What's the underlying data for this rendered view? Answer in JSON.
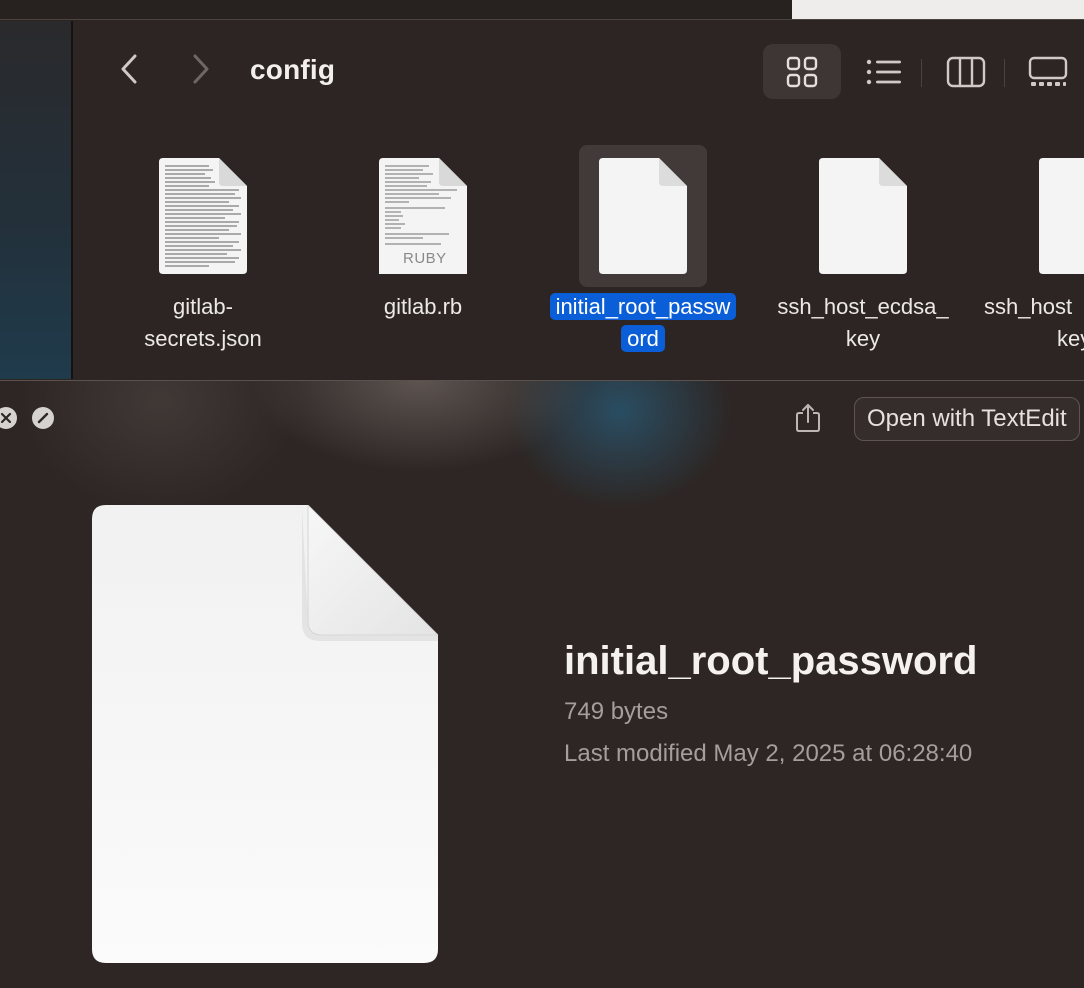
{
  "finder": {
    "folder_title": "config",
    "files": [
      {
        "name_line1": "gitlab-",
        "name_line2": "secrets.json",
        "type": "json-text-preview"
      },
      {
        "name_line1": "gitlab.rb",
        "name_line2": "",
        "type": "ruby-text-preview",
        "badge": "RUBY"
      },
      {
        "name_line1": "initial_root_passw",
        "name_line2": "ord",
        "type": "blank-document",
        "selected": true
      },
      {
        "name_line1": "ssh_host_ecdsa_",
        "name_line2": "key",
        "type": "blank-document"
      },
      {
        "name_line1": "ssh_host",
        "name_line2": "key.",
        "type": "blank-document"
      }
    ],
    "view_modes": [
      "icon-view-icon",
      "list-view-icon",
      "column-view-icon",
      "gallery-view-icon"
    ],
    "active_view": "icon-view-icon"
  },
  "quicklook": {
    "open_with_label": "Open with TextEdit",
    "file_name": "initial_root_password",
    "file_size": "749 bytes",
    "last_modified": "Last modified May 2, 2025 at 06:28:40"
  },
  "colors": {
    "selection": "#0a5ed7",
    "window_bg": "#2c2523"
  }
}
